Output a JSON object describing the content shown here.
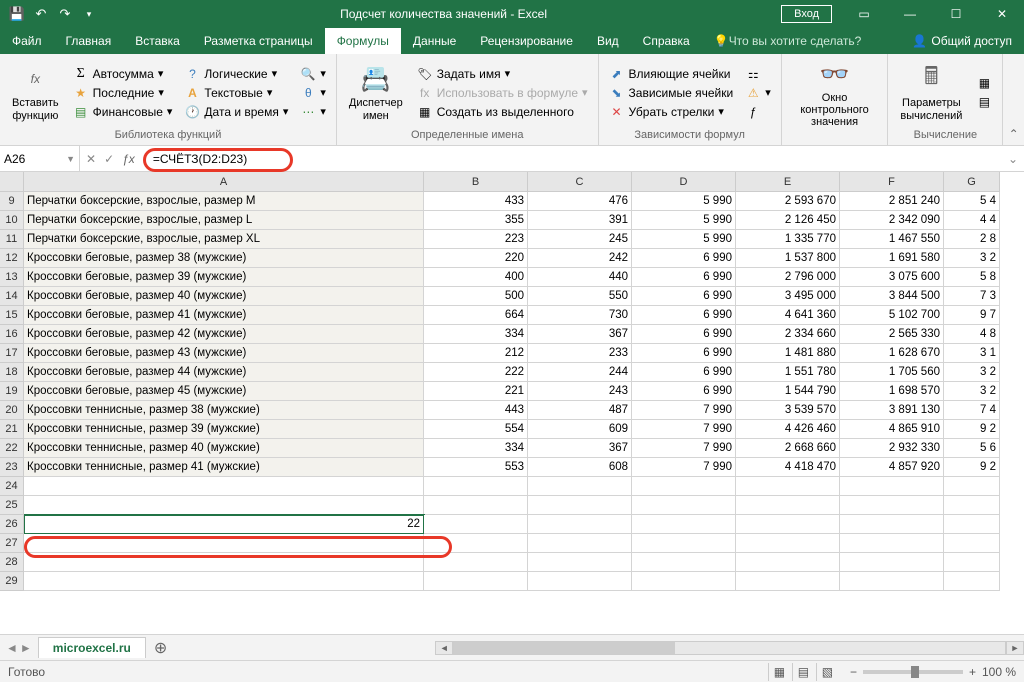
{
  "title": "Подсчет количества значений  -  Excel",
  "login": "Вход",
  "tabs": [
    "Файл",
    "Главная",
    "Вставка",
    "Разметка страницы",
    "Формулы",
    "Данные",
    "Рецензирование",
    "Вид",
    "Справка"
  ],
  "tellme": "Что вы хотите сделать?",
  "share": "Общий доступ",
  "ribbon": {
    "g1": {
      "btn": "Вставить\nфункцию",
      "lbl": "Библиотека функций",
      "a": "Автосумма",
      "b": "Последние",
      "c": "Финансовые",
      "d": "Логические",
      "e": "Текстовые",
      "f": "Дата и время"
    },
    "g2": {
      "btn": "Диспетчер\nимен",
      "lbl": "Определенные имена",
      "a": "Задать имя",
      "b": "Использовать в формуле",
      "c": "Создать из выделенного"
    },
    "g3": {
      "lbl": "Зависимости формул",
      "a": "Влияющие ячейки",
      "b": "Зависимые ячейки",
      "c": "Убрать стрелки"
    },
    "g4": {
      "btn": "Окно контрольного\nзначения"
    },
    "g5": {
      "btn": "Параметры\nвычислений",
      "lbl": "Вычисление"
    }
  },
  "namebox": "A26",
  "formula": "=СЧЁТЗ(D2:D23)",
  "cols": [
    "A",
    "B",
    "C",
    "D",
    "E",
    "F",
    "G"
  ],
  "rows": [
    {
      "n": 9,
      "a": "Перчатки боксерские, взрослые, размер M",
      "b": "433",
      "c": "476",
      "d": "5 990",
      "e": "2 593 670",
      "f": "2 851 240",
      "g": "5 4"
    },
    {
      "n": 10,
      "a": "Перчатки боксерские, взрослые, размер L",
      "b": "355",
      "c": "391",
      "d": "5 990",
      "e": "2 126 450",
      "f": "2 342 090",
      "g": "4 4"
    },
    {
      "n": 11,
      "a": "Перчатки боксерские, взрослые, размер XL",
      "b": "223",
      "c": "245",
      "d": "5 990",
      "e": "1 335 770",
      "f": "1 467 550",
      "g": "2 8"
    },
    {
      "n": 12,
      "a": "Кроссовки беговые, размер 38 (мужские)",
      "b": "220",
      "c": "242",
      "d": "6 990",
      "e": "1 537 800",
      "f": "1 691 580",
      "g": "3 2"
    },
    {
      "n": 13,
      "a": "Кроссовки беговые, размер 39 (мужские)",
      "b": "400",
      "c": "440",
      "d": "6 990",
      "e": "2 796 000",
      "f": "3 075 600",
      "g": "5 8"
    },
    {
      "n": 14,
      "a": "Кроссовки беговые, размер 40 (мужские)",
      "b": "500",
      "c": "550",
      "d": "6 990",
      "e": "3 495 000",
      "f": "3 844 500",
      "g": "7 3"
    },
    {
      "n": 15,
      "a": "Кроссовки беговые, размер 41 (мужские)",
      "b": "664",
      "c": "730",
      "d": "6 990",
      "e": "4 641 360",
      "f": "5 102 700",
      "g": "9 7"
    },
    {
      "n": 16,
      "a": "Кроссовки беговые, размер 42 (мужские)",
      "b": "334",
      "c": "367",
      "d": "6 990",
      "e": "2 334 660",
      "f": "2 565 330",
      "g": "4 8"
    },
    {
      "n": 17,
      "a": "Кроссовки беговые, размер 43 (мужские)",
      "b": "212",
      "c": "233",
      "d": "6 990",
      "e": "1 481 880",
      "f": "1 628 670",
      "g": "3 1"
    },
    {
      "n": 18,
      "a": "Кроссовки беговые, размер 44 (мужские)",
      "b": "222",
      "c": "244",
      "d": "6 990",
      "e": "1 551 780",
      "f": "1 705 560",
      "g": "3 2"
    },
    {
      "n": 19,
      "a": "Кроссовки беговые, размер 45 (мужские)",
      "b": "221",
      "c": "243",
      "d": "6 990",
      "e": "1 544 790",
      "f": "1 698 570",
      "g": "3 2"
    },
    {
      "n": 20,
      "a": "Кроссовки теннисные, размер 38 (мужские)",
      "b": "443",
      "c": "487",
      "d": "7 990",
      "e": "3 539 570",
      "f": "3 891 130",
      "g": "7 4"
    },
    {
      "n": 21,
      "a": "Кроссовки теннисные, размер 39 (мужские)",
      "b": "554",
      "c": "609",
      "d": "7 990",
      "e": "4 426 460",
      "f": "4 865 910",
      "g": "9 2"
    },
    {
      "n": 22,
      "a": "Кроссовки теннисные, размер 40 (мужские)",
      "b": "334",
      "c": "367",
      "d": "7 990",
      "e": "2 668 660",
      "f": "2 932 330",
      "g": "5 6"
    },
    {
      "n": 23,
      "a": "Кроссовки теннисные, размер 41 (мужские)",
      "b": "553",
      "c": "608",
      "d": "7 990",
      "e": "4 418 470",
      "f": "4 857 920",
      "g": "9 2"
    },
    {
      "n": 24,
      "blank": true
    },
    {
      "n": 25,
      "blank": true
    },
    {
      "n": 26,
      "a": "22",
      "sel": true,
      "right": true
    },
    {
      "n": 27,
      "blank": true
    },
    {
      "n": 28,
      "blank": true
    },
    {
      "n": 29,
      "blank": true
    }
  ],
  "sheet": "microexcel.ru",
  "status": "Готово",
  "zoom": "100 %"
}
